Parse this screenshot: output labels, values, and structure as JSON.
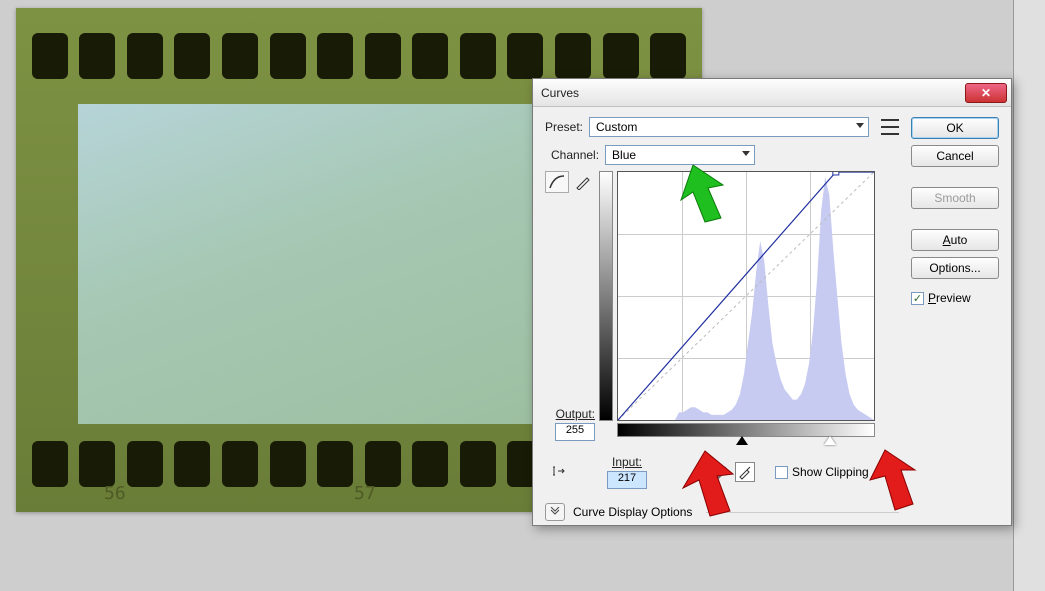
{
  "dialog": {
    "title": "Curves",
    "preset_label": "Preset:",
    "preset_value": "Custom",
    "channel_label": "Channel:",
    "channel_value": "Blue",
    "output_label": "Output:",
    "output_value": "255",
    "input_label": "Input:",
    "input_value": "217",
    "show_clipping_label": "Show Clipping",
    "curve_display_label": "Curve Display Options"
  },
  "buttons": {
    "ok": "OK",
    "cancel": "Cancel",
    "smooth": "Smooth",
    "auto": "Auto",
    "options": "Options...",
    "preview": "Preview"
  },
  "film": {
    "frame_a": "56",
    "frame_b": "57"
  },
  "chart_data": {
    "type": "line",
    "title": "Curves — Blue channel",
    "xlabel": "Input",
    "ylabel": "Output",
    "xlim": [
      0,
      255
    ],
    "ylim": [
      0,
      255
    ],
    "curve_points": [
      [
        0,
        0
      ],
      [
        217,
        255
      ],
      [
        239,
        255
      ]
    ],
    "black_point_input": 0,
    "white_point_input": 217,
    "histogram_note": "Blue-channel histogram peaks concentrated roughly in input range 90–240 with tallest spike near 200–215",
    "histogram_bins": [
      0,
      0,
      0,
      0,
      0,
      0,
      0,
      0,
      0,
      0,
      0,
      0,
      0,
      0,
      0,
      3,
      3,
      4,
      5,
      5,
      4,
      3,
      3,
      2,
      2,
      2,
      2,
      3,
      4,
      6,
      10,
      18,
      30,
      42,
      58,
      70,
      62,
      45,
      30,
      22,
      16,
      12,
      10,
      8,
      8,
      10,
      14,
      22,
      35,
      55,
      82,
      95,
      88,
      66,
      48,
      30,
      18,
      10,
      6,
      4,
      3,
      2,
      1,
      0
    ],
    "grid_divisions": 4
  }
}
